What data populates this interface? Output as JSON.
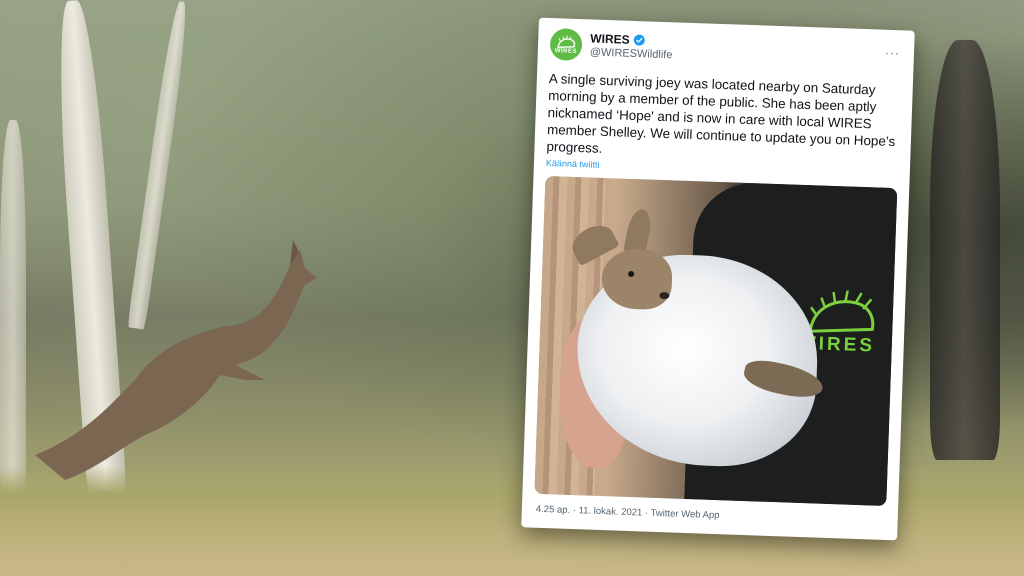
{
  "tweet": {
    "author_name": "WIRES",
    "author_handle": "@WIRESWildlife",
    "avatar_label": "WIRES",
    "verified_icon": "verified-badge-icon",
    "more_icon": "more-dots-icon",
    "more_label": "···",
    "text": "A single surviving joey was located nearby on Saturday morning by a member of the public. She has been aptly nicknamed ‘Hope' and is now in care with local WIRES member Shelley. We will continue to update you on Hope’s progress.",
    "translate_label": "Käännä twiitti",
    "media_text": "WIRES",
    "timestamp": "4.25 ap. · 11. lokak. 2021 · Twitter Web App"
  },
  "colors": {
    "accent_green": "#5fbb46",
    "link_blue": "#1d9bf0",
    "verified_blue": "#1d9bf0"
  }
}
